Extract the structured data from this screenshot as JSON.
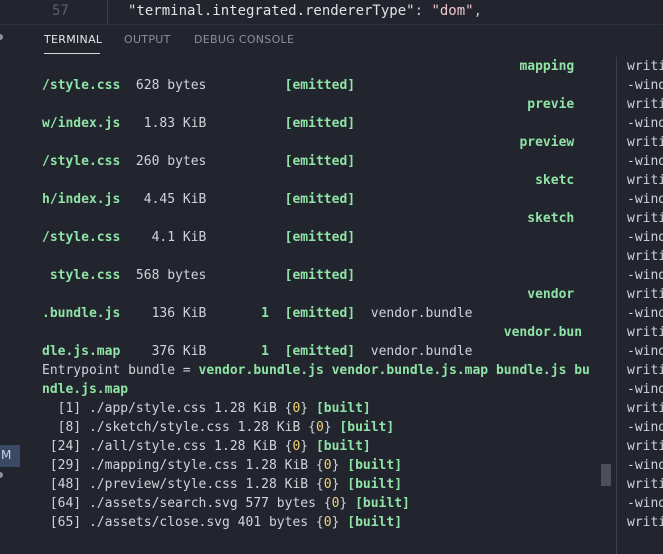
{
  "editor": {
    "line_number": "57",
    "code_key": "\"terminal.integrated.rendererType\"",
    "code_colon": ": ",
    "code_value": "\"dom\"",
    "code_comma": ","
  },
  "panel": {
    "tabs": [
      "TERMINAL",
      "OUTPUT",
      "DEBUG CONSOLE"
    ]
  },
  "sidebar": {
    "highlight_label": "M"
  },
  "terminal_lines": [
    [
      {
        "t": "                                                             ",
        "c": ""
      },
      {
        "t": "mapping",
        "c": "g"
      }
    ],
    [
      {
        "t": "/style.css",
        "c": "g"
      },
      {
        "t": "  628 bytes          ",
        "c": ""
      },
      {
        "t": "[emitted]",
        "c": "g"
      }
    ],
    [
      {
        "t": "                                                              ",
        "c": ""
      },
      {
        "t": "previe",
        "c": "g"
      }
    ],
    [
      {
        "t": "w/index.js",
        "c": "g"
      },
      {
        "t": "   1.83 KiB          ",
        "c": ""
      },
      {
        "t": "[emitted]",
        "c": "g"
      }
    ],
    [
      {
        "t": "                                                             ",
        "c": ""
      },
      {
        "t": "preview",
        "c": "g"
      }
    ],
    [
      {
        "t": "/style.css",
        "c": "g"
      },
      {
        "t": "  260 bytes          ",
        "c": ""
      },
      {
        "t": "[emitted]",
        "c": "g"
      }
    ],
    [
      {
        "t": "                                                               ",
        "c": ""
      },
      {
        "t": "sketc",
        "c": "g"
      }
    ],
    [
      {
        "t": "h/index.js",
        "c": "g"
      },
      {
        "t": "   4.45 KiB          ",
        "c": ""
      },
      {
        "t": "[emitted]",
        "c": "g"
      }
    ],
    [
      {
        "t": "                                                              ",
        "c": ""
      },
      {
        "t": "sketch",
        "c": "g"
      }
    ],
    [
      {
        "t": "/style.css",
        "c": "g"
      },
      {
        "t": "    4.1 KiB          ",
        "c": ""
      },
      {
        "t": "[emitted]",
        "c": "g"
      }
    ],
    [
      {
        "t": "",
        "c": ""
      }
    ],
    [
      {
        "t": " style.css",
        "c": "g"
      },
      {
        "t": "  568 bytes          ",
        "c": ""
      },
      {
        "t": "[emitted]",
        "c": "g"
      }
    ],
    [
      {
        "t": "                                                              ",
        "c": ""
      },
      {
        "t": "vendor",
        "c": "g"
      }
    ],
    [
      {
        "t": ".bundle.js",
        "c": "g"
      },
      {
        "t": "    136 KiB       ",
        "c": ""
      },
      {
        "t": "1",
        "c": "g"
      },
      {
        "t": "  ",
        "c": ""
      },
      {
        "t": "[emitted]",
        "c": "g"
      },
      {
        "t": "  vendor.bundle",
        "c": ""
      }
    ],
    [
      {
        "t": "                                                           ",
        "c": ""
      },
      {
        "t": "vendor.bun",
        "c": "g"
      }
    ],
    [
      {
        "t": "dle.js.map",
        "c": "g"
      },
      {
        "t": "    376 KiB       ",
        "c": ""
      },
      {
        "t": "1",
        "c": "g"
      },
      {
        "t": "  ",
        "c": ""
      },
      {
        "t": "[emitted]",
        "c": "g"
      },
      {
        "t": "  vendor.bundle",
        "c": ""
      }
    ],
    [
      {
        "t": "Entrypoint bundle = ",
        "c": ""
      },
      {
        "t": "vendor.bundle.js vendor.bundle.js.map bundle.js bu",
        "c": "g"
      }
    ],
    [
      {
        "t": "ndle.js.map",
        "c": "g"
      }
    ],
    [
      {
        "t": "  [1] ./app/style.css 1.28 KiB {",
        "c": ""
      },
      {
        "t": "0",
        "c": "y"
      },
      {
        "t": "} ",
        "c": ""
      },
      {
        "t": "[built]",
        "c": "g"
      }
    ],
    [
      {
        "t": "  [8] ./sketch/style.css 1.28 KiB {",
        "c": ""
      },
      {
        "t": "0",
        "c": "y"
      },
      {
        "t": "} ",
        "c": ""
      },
      {
        "t": "[built]",
        "c": "g"
      }
    ],
    [
      {
        "t": " [24] ./all/style.css 1.28 KiB {",
        "c": ""
      },
      {
        "t": "0",
        "c": "y"
      },
      {
        "t": "} ",
        "c": ""
      },
      {
        "t": "[built]",
        "c": "g"
      }
    ],
    [
      {
        "t": " [29] ./mapping/style.css 1.28 KiB {",
        "c": ""
      },
      {
        "t": "0",
        "c": "y"
      },
      {
        "t": "} ",
        "c": ""
      },
      {
        "t": "[built]",
        "c": "g"
      }
    ],
    [
      {
        "t": " [48] ./preview/style.css 1.28 KiB {",
        "c": ""
      },
      {
        "t": "0",
        "c": "y"
      },
      {
        "t": "} ",
        "c": ""
      },
      {
        "t": "[built]",
        "c": "g"
      }
    ],
    [
      {
        "t": " [64] ./assets/search.svg 577 bytes {",
        "c": ""
      },
      {
        "t": "0",
        "c": "y"
      },
      {
        "t": "} ",
        "c": ""
      },
      {
        "t": "[built]",
        "c": "g"
      }
    ],
    [
      {
        "t": " [65] ./assets/close.svg 401 bytes {",
        "c": ""
      },
      {
        "t": "0",
        "c": "y"
      },
      {
        "t": "} ",
        "c": ""
      },
      {
        "t": "[built]",
        "c": "g"
      }
    ]
  ],
  "right_terminal_lines": [
    "writi",
    "-wind",
    "writi",
    "-wind",
    "writi",
    "-wind",
    "writi",
    "-wind",
    "writi",
    "-wind",
    "writi",
    "-wind",
    "writi",
    "-wind",
    "writi",
    "-wind",
    "writi",
    "-wind",
    "writi",
    "-wind",
    "writi",
    "-wind",
    "writi",
    "-wind",
    "writi"
  ]
}
